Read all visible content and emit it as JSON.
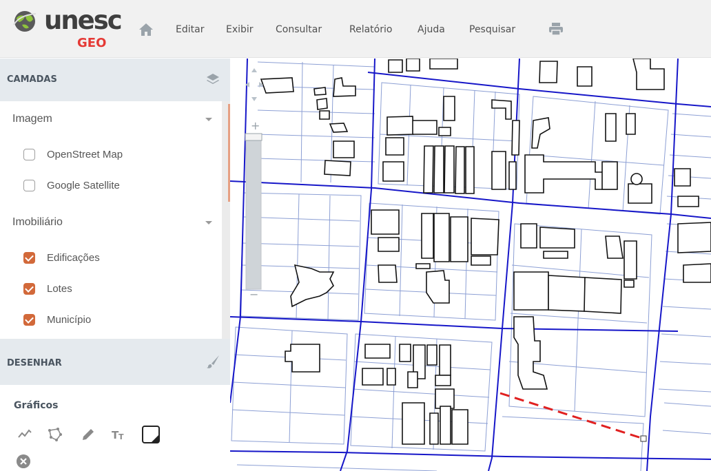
{
  "app": {
    "logo_text": "unesc",
    "logo_sub": "GEO"
  },
  "menu": [
    {
      "label": "Editar"
    },
    {
      "label": "Exibir"
    },
    {
      "label": "Consultar"
    },
    {
      "label": "Relatório"
    },
    {
      "label": "Ajuda"
    },
    {
      "label": "Pesquisar"
    }
  ],
  "icons": {
    "home": "home-icon",
    "print": "print-icon"
  },
  "sidebar": {
    "layers_title": "CAMADAS",
    "groups": [
      {
        "label": "Imagem",
        "layers": [
          {
            "label": "OpenStreet Map",
            "checked": false
          },
          {
            "label": "Google Satellite",
            "checked": false
          }
        ]
      },
      {
        "label": "Imobiliário",
        "layers": [
          {
            "label": "Edificações",
            "checked": true
          },
          {
            "label": "Lotes",
            "checked": true
          },
          {
            "label": "Município",
            "checked": true
          }
        ]
      }
    ],
    "draw_title": "DESENHAR",
    "graphics_title": "Gráficos",
    "tools": [
      "polyline-icon",
      "polygon-icon",
      "pencil-icon",
      "text-icon",
      "color-swatch-icon",
      "clear-icon"
    ]
  },
  "colors": {
    "accent": "#d2693a",
    "street": "#1010c8",
    "lot": "#8c9fd4",
    "building": "#111111",
    "measure": "#e02020"
  }
}
